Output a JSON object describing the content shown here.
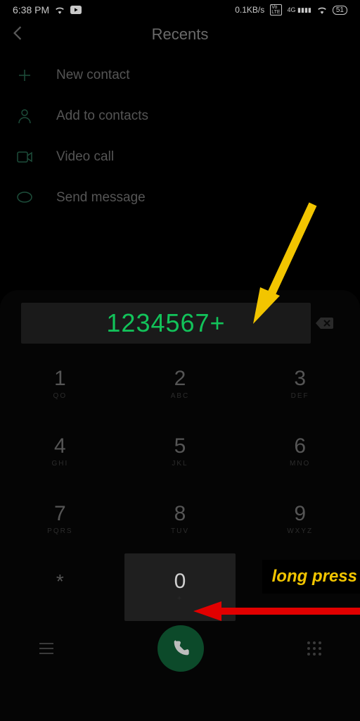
{
  "status": {
    "time": "6:38 PM",
    "net_speed": "0.1KB/s",
    "battery": "51"
  },
  "header": {
    "title": "Recents"
  },
  "actions": {
    "new_contact": "New contact",
    "add_to_contacts": "Add to contacts",
    "video_call": "Video call",
    "send_message": "Send message"
  },
  "dialed_number": "1234567+",
  "keypad": {
    "k1": {
      "main": "1",
      "sub": "QO"
    },
    "k2": {
      "main": "2",
      "sub": "ABC"
    },
    "k3": {
      "main": "3",
      "sub": "DEF"
    },
    "k4": {
      "main": "4",
      "sub": "GHI"
    },
    "k5": {
      "main": "5",
      "sub": "JKL"
    },
    "k6": {
      "main": "6",
      "sub": "MNO"
    },
    "k7": {
      "main": "7",
      "sub": "PQRS"
    },
    "k8": {
      "main": "8",
      "sub": "TUV"
    },
    "k9": {
      "main": "9",
      "sub": "WXYZ"
    },
    "kstar": {
      "main": "*",
      "sub": ""
    },
    "k0": {
      "main": "0",
      "sub": "+"
    },
    "khash": {
      "main": "#",
      "sub": ""
    }
  },
  "annotation": {
    "long_press": "long press"
  }
}
